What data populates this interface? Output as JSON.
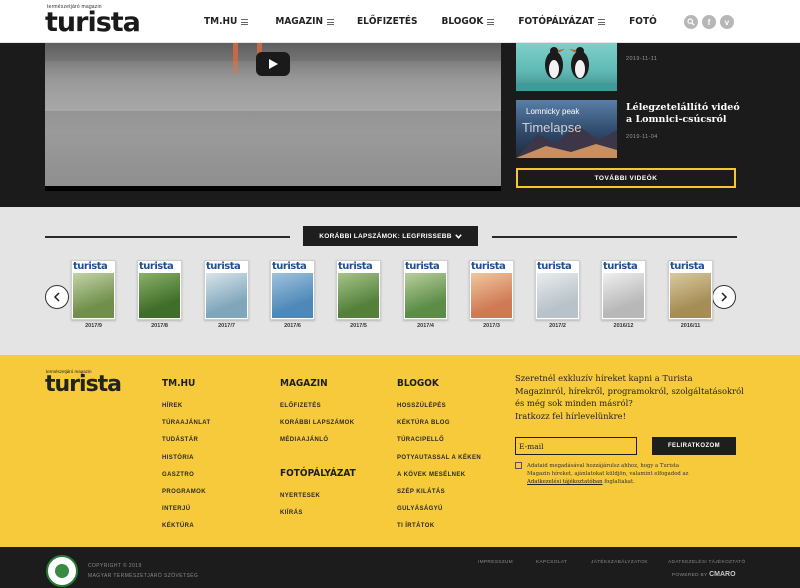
{
  "header": {
    "logo_tag": "természetjáró magazin",
    "logo_word": "turista",
    "nav": [
      {
        "label": "TM.HU",
        "menu": true
      },
      {
        "label": "MAGAZIN",
        "menu": true
      },
      {
        "label": "ELŐFIZETÉS",
        "menu": false
      },
      {
        "label": "BLOGOK",
        "menu": true
      },
      {
        "label": "FOTÓPÁLYÁZAT",
        "menu": true
      },
      {
        "label": "FOTÓ",
        "menu": false
      }
    ],
    "icons": [
      "search-icon",
      "facebook-icon",
      "vimeo-icon"
    ]
  },
  "videos": {
    "items": [
      {
        "title": "",
        "date": "2019-11-11"
      },
      {
        "title": "Lélegzetelállító videó a Lomnici-csúcsról",
        "date": "2019-11-04",
        "thumb_text_1": "Lomnicky peak",
        "thumb_text_2": "Timelapse"
      }
    ],
    "more_label": "TOVÁBBI VIDEÓK"
  },
  "issues": {
    "tab_label": "KORÁBBI LAPSZÁMOK: LEGFRISSEBB",
    "cover_title": "turista",
    "items": [
      {
        "label": "2017/9",
        "c1": "#6f8f4a",
        "c2": "#c5d3a8"
      },
      {
        "label": "2017/8",
        "c1": "#3f6d2a",
        "c2": "#8ab266"
      },
      {
        "label": "2017/7",
        "c1": "#7fa6bb",
        "c2": "#d8e4ea"
      },
      {
        "label": "2017/6",
        "c1": "#4d88b8",
        "c2": "#9fc3dd"
      },
      {
        "label": "2017/5",
        "c1": "#54803a",
        "c2": "#a6c48a"
      },
      {
        "label": "2017/4",
        "c1": "#5c8d47",
        "c2": "#b8cf9c"
      },
      {
        "label": "2017/3",
        "c1": "#d07a55",
        "c2": "#f0c8a0"
      },
      {
        "label": "2017/2",
        "c1": "#b9c2c8",
        "c2": "#e8ecef"
      },
      {
        "label": "2016/12",
        "c1": "#b8b8b8",
        "c2": "#efefef"
      },
      {
        "label": "2016/11",
        "c1": "#a68c55",
        "c2": "#d8caa0"
      }
    ]
  },
  "footer": {
    "logo_tag": "természetjáró magazin",
    "logo_word": "turista",
    "columns": {
      "tmhu": {
        "title": "TM.HU",
        "links": [
          "HÍREK",
          "TÚRAAJÁNLAT",
          "TUDÁSTÁR",
          "HISTÓRIA",
          "GASZTRO",
          "PROGRAMOK",
          "INTERJÚ",
          "KÉKTÚRA"
        ]
      },
      "magazin": {
        "title": "MAGAZIN",
        "links": [
          "ELŐFIZETÉS",
          "KORÁBBI LAPSZÁMOK",
          "MÉDIAAJÁNLÓ"
        ]
      },
      "fotopalyazat": {
        "title": "FOTÓPÁLYÁZAT",
        "links": [
          "NYERTESEK",
          "KIÍRÁS"
        ]
      },
      "blogok": {
        "title": "BLOGOK",
        "links": [
          "HOSSZÚLÉPÉS",
          "KÉKTÚRA BLOG",
          "TÚRACIPELLŐ",
          "POTYAUTASSAL A KÉKEN",
          "A KÖVEK MESÉLNEK",
          "SZÉP KILÁTÁS",
          "GULYÁSÁGYÚ",
          "TI ÍRTÁTOK"
        ]
      }
    },
    "newsletter": {
      "text": "Szeretnél exkluzív híreket kapni a Turista Magazinról, hírekről, programokról, szolgáltatásokról és még sok minden másról?",
      "text2": "Iratkozz fel hírlevelünkre!",
      "email_placeholder": "E-mail",
      "subscribe_label": "FELIRATKOZOM",
      "consent_before": "Adataid megadásával hozzájárulsz ahhoz, hogy a Turista Magazin híreket, ajánlatokat küldjön, valamint elfogadod az",
      "consent_link": "Adatkezelési tájékoztatóban",
      "consent_after": "foglaltakat."
    }
  },
  "bottom": {
    "copyright": "COPYRIGHT © 2019",
    "org": "MAGYAR TERMÉSZETJÁRÓ SZÖVETSÉG",
    "links": [
      "IMPRESSZUM",
      "KAPCSOLAT",
      "JÁTÉKSZABÁLYZATOK",
      "ADATKEZELÉSI TÁJÉKOZTATÓ"
    ],
    "powered_label": "POWERED BY",
    "powered_brand": "CMARO"
  }
}
